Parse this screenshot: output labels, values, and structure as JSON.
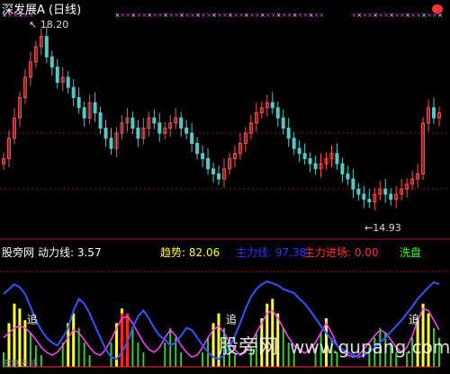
{
  "header": {
    "title": "深发展A (日线)",
    "title_color": "#ffffff"
  },
  "price_panel": {
    "high_label": "18.20",
    "low_label": "14.93",
    "up_color": "#ff4d4d",
    "down_color": "#55c8c8"
  },
  "indicator_header": {
    "name": "股旁网",
    "items": [
      {
        "label": "动力线:",
        "value": "3.57",
        "color": "#ffffff"
      },
      {
        "label": "趋势:",
        "value": "82.06",
        "color": "#ffff33"
      },
      {
        "label": "主力线:",
        "value": "97.38",
        "color": "#3333ff"
      },
      {
        "label": "主力进场:",
        "value": "0.00",
        "color": "#ff3333"
      },
      {
        "label": "洗盘",
        "value": "",
        "color": "#33ff33"
      }
    ]
  },
  "annotations": {
    "zhui_label": "追",
    "watermark_text": "股旁网",
    "watermark_url": "www.gupang.com",
    "bottom_left_text": "田惠云柿"
  },
  "chart_data": {
    "type": "line",
    "price_ylim": [
      14.5,
      18.6
    ],
    "indicator_ylim": [
      0,
      100
    ],
    "series": [
      {
        "values": [
          15.8,
          16.2,
          16.6,
          17.0,
          17.4,
          17.7,
          18.0,
          18.2,
          17.8,
          17.6,
          17.3,
          17.4,
          17.2,
          17.0,
          16.8,
          16.6,
          16.9,
          16.7,
          16.4,
          16.2,
          16.0,
          16.3,
          16.5,
          16.6,
          16.4,
          16.2,
          16.4,
          16.6,
          16.5,
          16.3,
          16.4,
          16.5,
          16.6,
          16.4,
          16.3,
          16.1,
          15.9,
          15.8,
          15.6,
          15.5,
          15.4,
          15.6,
          15.8,
          15.9,
          16.1,
          16.3,
          16.5,
          16.7,
          16.8,
          16.9,
          16.8,
          16.6,
          16.4,
          16.2,
          16.0,
          15.9,
          15.8,
          15.7,
          15.6,
          15.7,
          15.8,
          15.9,
          15.7,
          15.5,
          15.4,
          15.2,
          15.1,
          15.0,
          14.95,
          15.1,
          15.2,
          15.1,
          15.0,
          15.1,
          15.2,
          15.3,
          15.4,
          15.5,
          16.5,
          16.8,
          16.6,
          16.7
        ]
      },
      {
        "values": [
          75,
          80,
          85,
          82,
          75,
          62,
          48,
          38,
          30,
          25,
          22,
          30,
          40,
          58,
          70,
          65,
          55,
          42,
          30,
          18,
          10,
          8,
          15,
          25,
          40,
          52,
          58,
          50,
          40,
          32,
          28,
          22,
          25,
          32,
          40,
          38,
          30,
          22,
          15,
          10,
          8,
          12,
          20,
          32,
          45,
          60,
          72,
          80,
          85,
          88,
          86,
          84,
          80,
          78,
          76,
          70,
          65,
          58,
          50,
          42,
          35,
          28,
          22,
          18,
          15,
          12,
          10,
          12,
          15,
          20,
          25,
          30,
          36,
          42,
          48,
          55,
          62,
          70,
          76,
          82,
          87,
          85
        ]
      },
      {
        "values": [
          0,
          0,
          0,
          0,
          0,
          0,
          0,
          0,
          0,
          0,
          0,
          0,
          0,
          0,
          0,
          0,
          0,
          0,
          0,
          0,
          0,
          0,
          0,
          0,
          0,
          0,
          0,
          0,
          0,
          0,
          0,
          0,
          0,
          0,
          0,
          0,
          0,
          0,
          0,
          0,
          0,
          0,
          0,
          0,
          0,
          0,
          0,
          0,
          0,
          0,
          0,
          0,
          0,
          0,
          0,
          0,
          0,
          0,
          0,
          0,
          0,
          0,
          0,
          0,
          0,
          0,
          0,
          0,
          0,
          0,
          0,
          0,
          0,
          0,
          0,
          0,
          0,
          0,
          0,
          0,
          0,
          0
        ]
      },
      {
        "values": [
          15,
          45,
          65,
          60,
          48,
          35,
          22,
          12,
          5,
          3,
          8,
          25,
          45,
          55,
          40,
          25,
          12,
          5,
          3,
          10,
          25,
          45,
          60,
          55,
          40,
          25,
          15,
          8,
          5,
          10,
          25,
          40,
          30,
          15,
          8,
          3,
          5,
          15,
          30,
          45,
          55,
          40,
          25,
          12,
          5,
          8,
          20,
          35,
          50,
          65,
          70,
          55,
          40,
          25,
          15,
          10,
          5,
          10,
          20,
          35,
          50,
          30,
          15,
          8,
          5,
          3,
          5,
          10,
          20,
          30,
          40,
          35,
          25,
          15,
          10,
          15,
          30,
          50,
          65,
          55,
          40,
          30
        ]
      },
      {
        "values": [
          30,
          35,
          40,
          42,
          40,
          35,
          28,
          20,
          15,
          12,
          15,
          22,
          30,
          38,
          35,
          28,
          20,
          14,
          12,
          18,
          28,
          40,
          50,
          52,
          45,
          35,
          25,
          18,
          15,
          20,
          30,
          38,
          32,
          22,
          15,
          10,
          12,
          20,
          30,
          38,
          42,
          35,
          25,
          18,
          12,
          15,
          25,
          35,
          45,
          55,
          58,
          50,
          40,
          30,
          22,
          18,
          14,
          18,
          25,
          35,
          45,
          35,
          22,
          15,
          12,
          10,
          12,
          18,
          25,
          32,
          38,
          35,
          28,
          20,
          15,
          20,
          32,
          48,
          60,
          58,
          48,
          38
        ]
      }
    ],
    "grid": false
  }
}
